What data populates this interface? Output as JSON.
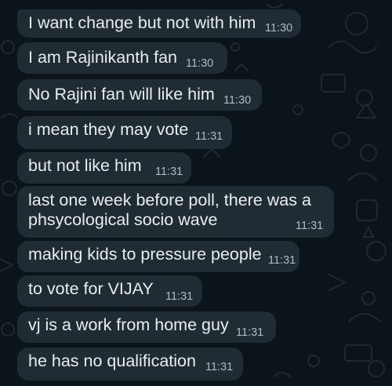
{
  "theme": {
    "background": "#0b141a",
    "bubble_incoming": "#202c33",
    "text_primary": "#e9edef",
    "text_time": "#aebac1"
  },
  "messages": [
    {
      "text": "I want change but not with him",
      "time": "11:30"
    },
    {
      "text": "I am Rajinikanth fan",
      "time": "11:30"
    },
    {
      "text": "No Rajini fan will like him",
      "time": "11:30"
    },
    {
      "text": "i mean they may vote",
      "time": "11:31"
    },
    {
      "text": "but not like him",
      "time": "11:31"
    },
    {
      "text_line1": "last one week before poll, there was a",
      "text_line2": "phsycological socio wave",
      "time": "11:31"
    },
    {
      "text": "making kids to pressure people",
      "time": "11:31"
    },
    {
      "text": "to vote for VIJAY",
      "time": "11:31"
    },
    {
      "text": "vj is a work from home guy",
      "time": "11:31"
    },
    {
      "text": "he has no qualification",
      "time": "11:31"
    }
  ]
}
